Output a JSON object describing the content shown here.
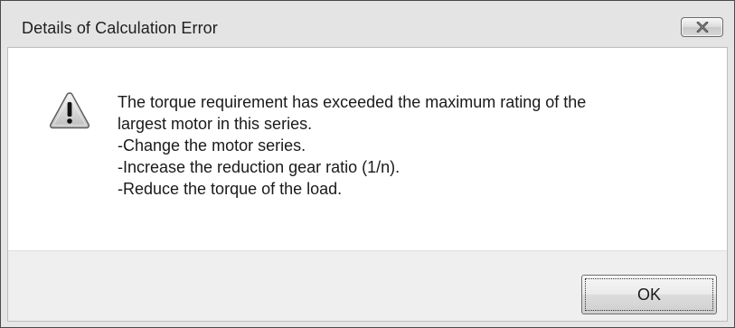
{
  "window": {
    "title": "Details of Calculation Error"
  },
  "icons": {
    "close": "close-icon",
    "warning": "warning-icon"
  },
  "message": {
    "lines": [
      "The torque requirement has exceeded the maximum rating of the",
      "largest motor in this series.",
      "-Change the motor series.",
      "-Increase the reduction gear ratio (1/n).",
      "-Reduce the torque of the load."
    ]
  },
  "buttons": {
    "ok_label": "OK"
  },
  "colors": {
    "warning_fill": "#d8d8d8",
    "warning_outline": "#5a5a5a",
    "warning_mark": "#111111"
  }
}
